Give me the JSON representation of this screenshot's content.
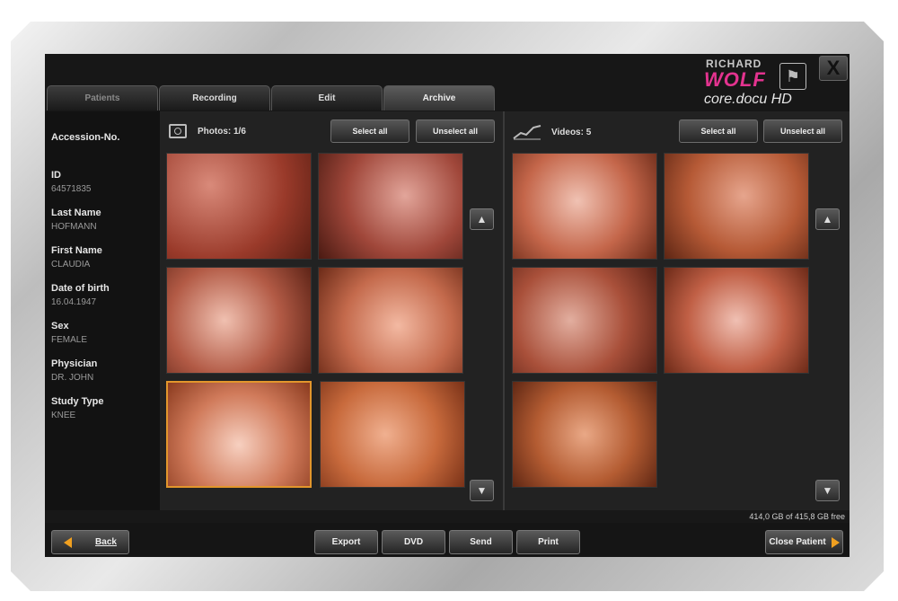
{
  "tabs": [
    {
      "label": "Patients"
    },
    {
      "label": "Recording"
    },
    {
      "label": "Edit"
    },
    {
      "label": "Archive"
    }
  ],
  "logo": {
    "brand_top": "RICHARD",
    "brand_main": "WOLF",
    "product": "core.docu  HD",
    "brand_color": "#e3338f"
  },
  "close_label": "X",
  "patient": {
    "accession": {
      "label": "Accession-No.",
      "value": ""
    },
    "id": {
      "label": "ID",
      "value": "64571835"
    },
    "last_name": {
      "label": "Last Name",
      "value": "HOFMANN"
    },
    "first_name": {
      "label": "First Name",
      "value": "CLAUDIA"
    },
    "dob": {
      "label": "Date of birth",
      "value": "16.04.1947"
    },
    "sex": {
      "label": "Sex",
      "value": "FEMALE"
    },
    "physician": {
      "label": "Physician",
      "value": "DR. JOHN"
    },
    "study_type": {
      "label": "Study Type",
      "value": "KNEE"
    }
  },
  "photos": {
    "title": "Photos: 1/6",
    "select_all": "Select all",
    "unselect_all": "Unselect all",
    "icon": "camera-icon",
    "count": 6,
    "selected_index": 4
  },
  "videos": {
    "title": "Videos: 5",
    "select_all": "Select all",
    "unselect_all": "Unselect all",
    "icon": "video-chart-icon",
    "count": 5
  },
  "status": {
    "storage": "414,0 GB of 415,8 GB free"
  },
  "bottom": {
    "back": "Back",
    "export": "Export",
    "dvd": "DVD",
    "send": "Send",
    "print": "Print",
    "close_patient": "Close Patient"
  },
  "colors": {
    "accent": "#f0a020",
    "selection": "#e2962c"
  }
}
